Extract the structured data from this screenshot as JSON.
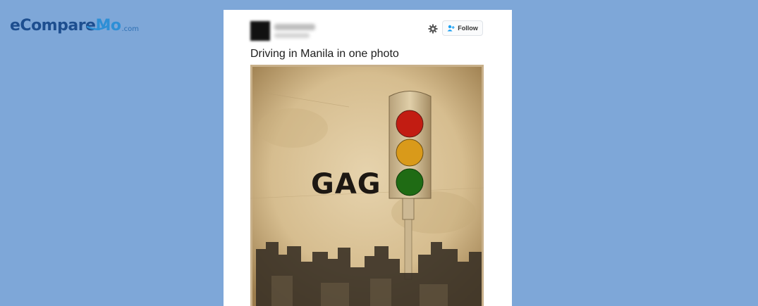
{
  "brand": {
    "logo_main": "eCompare",
    "logo_accent": "Mo",
    "logo_suffix": ".com"
  },
  "tweet": {
    "follow_label": "Follow",
    "text": "Driving in Manila in one photo",
    "image_caption_text": "GAG"
  },
  "colors": {
    "background": "#7ea7d8",
    "brand_dark": "#1d4e8f",
    "brand_light": "#2d8fd6",
    "follow_icon": "#1da1f2"
  },
  "icons": {
    "settings": "gear-icon",
    "follow": "add-user-icon"
  }
}
